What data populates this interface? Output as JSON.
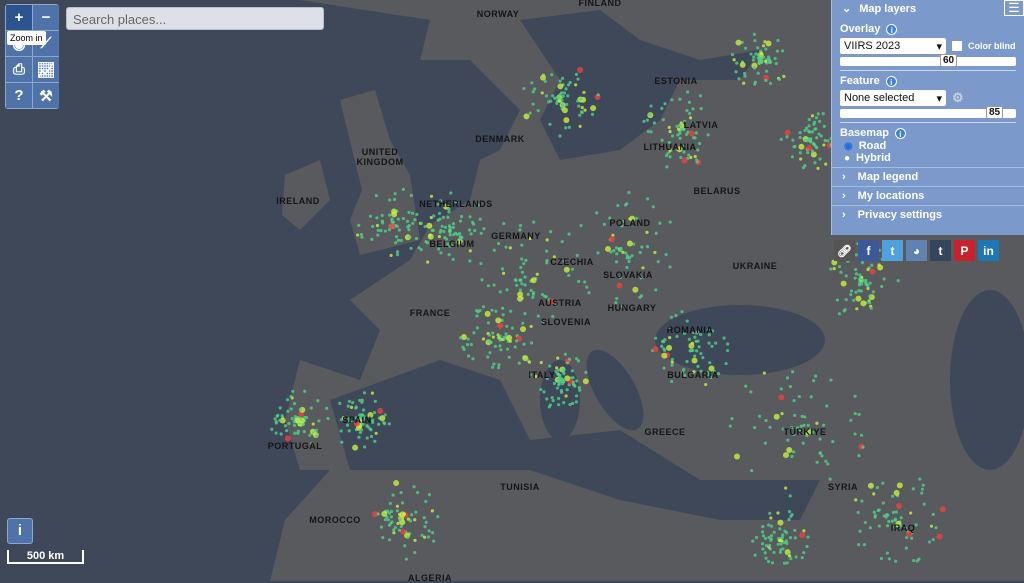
{
  "toolbar": {
    "zoom_in": "+",
    "zoom_out": "−",
    "tooltip": "Zoom in",
    "help": "?"
  },
  "search": {
    "placeholder": "Search places..."
  },
  "panel": {
    "title": "Map layers",
    "overlay_label": "Overlay",
    "overlay_value": "VIIRS 2023",
    "color_blind": "Color blind",
    "overlay_opacity": 60,
    "feature_label": "Feature",
    "feature_value": "None selected",
    "feature_opacity": 85,
    "basemap_label": "Basemap",
    "basemap_options": [
      "Road",
      "Hybrid"
    ],
    "basemap_selected": "Road",
    "sections": [
      "Map legend",
      "My locations",
      "Privacy settings"
    ]
  },
  "social": [
    "link",
    "f",
    "t",
    "reddit",
    "t",
    "P",
    "in"
  ],
  "social_colors": [
    "#555",
    "#3b5998",
    "#4ea1dd",
    "#5f82b0",
    "#34465d",
    "#c8232c",
    "#1e77b5"
  ],
  "info_button": "i",
  "scale": "500 km",
  "labels": [
    "NORWAY",
    "FINLAND",
    "UNITED KINGDOM",
    "IRELAND",
    "DENMARK",
    "NETHERLANDS",
    "BELGIUM",
    "GERMANY",
    "POLAND",
    "CZECHIA",
    "SLOVAKIA",
    "AUSTRIA",
    "HUNGARY",
    "SLOVENIA",
    "FRANCE",
    "ROMANIA",
    "BULGARIA",
    "GREECE",
    "SPAIN",
    "PORTUGAL",
    "ITALY",
    "TUNISIA",
    "MOROCCO",
    "ALGERIA",
    "ESTONIA",
    "LATVIA",
    "LITHUANIA",
    "BELARUS",
    "UKRAINE",
    "TÜRKIYE",
    "SYRIA",
    "IRAQ"
  ],
  "colors": {
    "sea": "#3f4859",
    "land": "#595b5f",
    "light_low": "#4fd08a",
    "light_mid": "#c8f03c",
    "light_high": "#f04040",
    "panel": "#7b9acb"
  }
}
